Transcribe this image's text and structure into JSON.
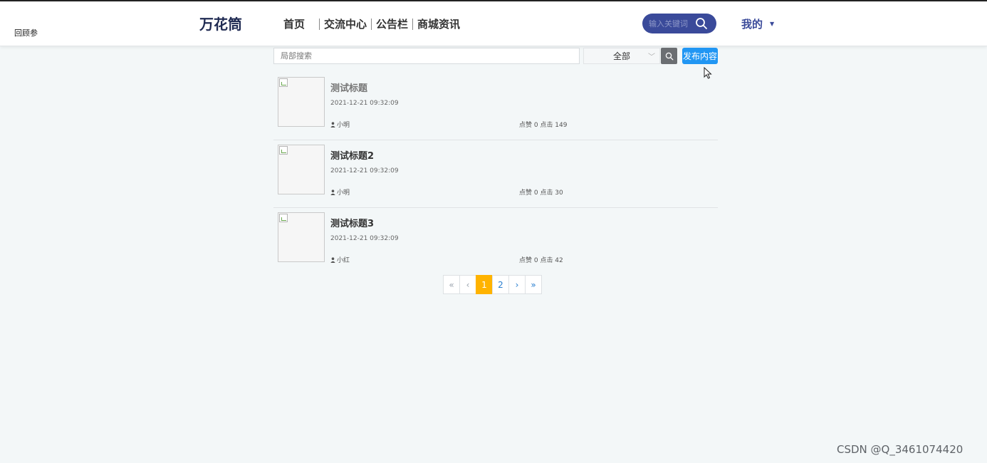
{
  "header": {
    "corner_text": "回顾参",
    "brand": "万花筒",
    "nav": [
      "首页",
      "交流中心",
      "公告栏",
      "商城资讯"
    ],
    "search_placeholder": "输入关键词",
    "mine_label": "我的"
  },
  "toolbar": {
    "local_search_placeholder": "局部搜索",
    "category_selected": "全部",
    "publish_label": "发布内容"
  },
  "items": [
    {
      "title": "测试标题",
      "date": "2021-12-21 09:32:09",
      "author": "小明",
      "stats": "点赞 0 点击 149"
    },
    {
      "title": "测试标题2",
      "date": "2021-12-21 09:32:09",
      "author": "小明",
      "stats": "点赞 0 点击 30"
    },
    {
      "title": "测试标题3",
      "date": "2021-12-21 09:32:09",
      "author": "小红",
      "stats": "点赞 0 点击 42"
    }
  ],
  "pagination": {
    "first": "«",
    "prev": "‹",
    "pages": [
      "1",
      "2"
    ],
    "current": "1",
    "next": "›",
    "last": "»"
  },
  "watermark": "CSDN @Q_3461074420",
  "colors": {
    "brand": "#1f2a52",
    "search_pill": "#3a4a9a",
    "publish_button": "#2196f3",
    "active_page": "#ffb300"
  },
  "icons": {
    "search": "magnifier-icon",
    "user": "user-icon",
    "caret": "caret-down-icon",
    "select": "chevron-down-icon"
  }
}
